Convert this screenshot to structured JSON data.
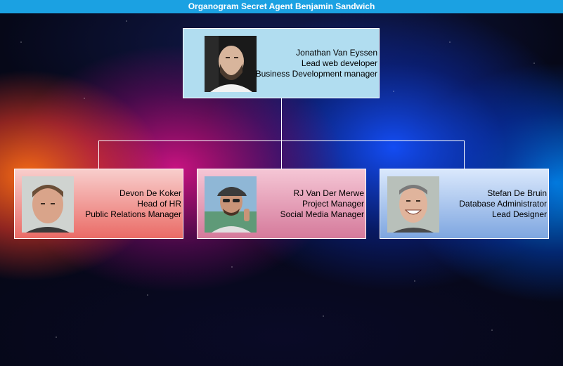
{
  "title": "Organogram Secret Agent Benjamin Sandwich",
  "root": {
    "name": "Jonathan Van Eyssen",
    "role1": "Lead web developer",
    "role2": "Business Development manager",
    "photo": "man-bald-beard-portrait"
  },
  "children": [
    {
      "name": "Devon De Koker",
      "role1": "Head of HR",
      "role2": "Public Relations Manager",
      "photo": "man-short-hair-portrait"
    },
    {
      "name": "RJ Van Der Merwe",
      "role1": "Project Manager",
      "role2": "Social Media Manager",
      "photo": "man-cap-sunglasses-portrait"
    },
    {
      "name": "Stefan De Bruin",
      "role1": "Database Administrator",
      "role2": "Lead Designer",
      "photo": "man-smiling-portrait"
    }
  ],
  "colors": {
    "title_bar": "#1ba1e2",
    "root_fill": "#b1ddf0",
    "child1_fill": "#ea6b66",
    "child2_fill": "#d57a9b",
    "child3_fill": "#7ea6e0"
  }
}
